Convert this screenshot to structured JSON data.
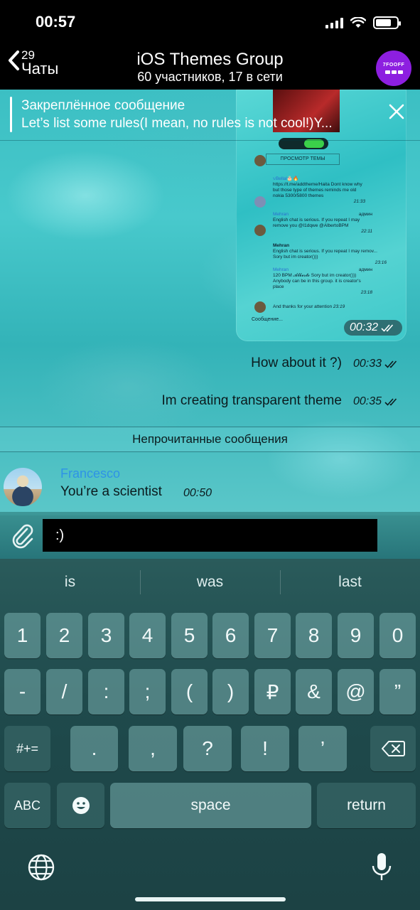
{
  "status": {
    "time": "00:57"
  },
  "nav": {
    "back_count": "29",
    "back_label": "Чаты",
    "title": "iOS Themes Group",
    "subtitle": "60 участников, 17 в сети",
    "avatar_text": "7FOOFF"
  },
  "pinned": {
    "title": "Закреплённое сообщение",
    "text": "Let’s list some rules(I mean, no rules is not cool!)Y..."
  },
  "image_message": {
    "time": "00:32",
    "mini": {
      "button": "ПРОСМОТР ТЕМЫ",
      "m1_name": "𝕧Bellal🎂🔥",
      "m1_text": "https://t.me/addtheme/Haita Dont know why but those type of themes reminds me old nokia 5300/5800 themes",
      "m1_time": "21:33",
      "m2_name": "Mehran",
      "m2_role": "админ",
      "m2_text": "English chat is serious. If you repeat I may remove you @I1dqwe @AlbertoBPM",
      "m2_time": "22:11",
      "m3_name": "Mehran",
      "m3_text": "English chat is serious. If you repeat I may remov... Sory but im creator()))",
      "m3_time": "23:16",
      "m4_name": "Mehran",
      "m4_role": "админ",
      "m4_text": "120 BPM 𝓐𝓵𝓫𝓮𝓻𝓽𝓸 Sory but im creator()))",
      "m4_text2": "Anybody can be in this group. it is creator's place",
      "m4_time": "23:18",
      "m5_text": "And thanks for your attention",
      "m5_time": "23:19",
      "input": "Сообщение..."
    }
  },
  "messages_out": [
    {
      "text": "How about it ?)",
      "time": "00:33"
    },
    {
      "text": "Im creating transparent theme",
      "time": "00:35"
    }
  ],
  "unread_divider": "Непрочитанные сообщения",
  "message_in": {
    "name": "Francesco",
    "text": "You’re a scientist",
    "time": "00:50"
  },
  "composer": {
    "value": ":)"
  },
  "keyboard": {
    "suggestions": [
      "is",
      "was",
      "last"
    ],
    "row1": [
      "1",
      "2",
      "3",
      "4",
      "5",
      "6",
      "7",
      "8",
      "9",
      "0"
    ],
    "row2": [
      "-",
      "/",
      ":",
      ";",
      "(",
      ")",
      "₽",
      "&",
      "@",
      "”"
    ],
    "row3_left": "#+=",
    "row3": [
      ".",
      ",",
      "?",
      "!",
      "’"
    ],
    "row4": {
      "abc": "ABC",
      "space": "space",
      "return": "return"
    }
  },
  "colors": {
    "name_blue": "#2e93e6",
    "avatar_purple": "#8d1fe0"
  }
}
